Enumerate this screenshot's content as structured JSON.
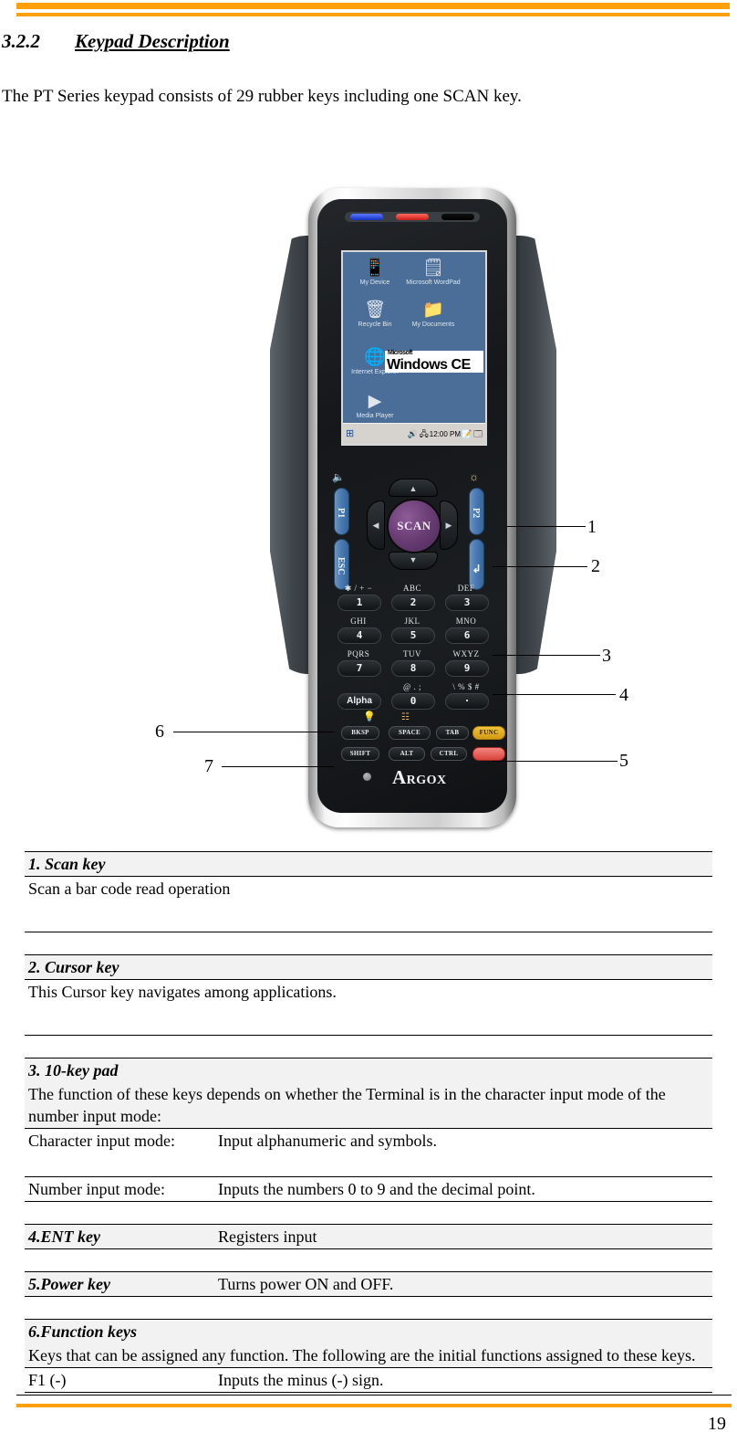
{
  "header": {
    "accent_color": "#FFA00A",
    "section_number": "3.2.2",
    "section_title": "Keypad Description"
  },
  "intro": "The PT Series keypad consists of 29 rubber keys including one SCAN key.",
  "device": {
    "brand_first_letter": "A",
    "brand_rest": "RGOX",
    "leds": [
      "led-blue",
      "led-red",
      "led-dark"
    ],
    "screen": {
      "os_logo_small": "Microsoft",
      "os_logo_large": "Windows CE",
      "icons": [
        {
          "name": "my-device",
          "glyph": "📱",
          "label": "My Device"
        },
        {
          "name": "microsoft-wordpad",
          "glyph": "🗒",
          "label": "Microsoft WordPad"
        },
        {
          "name": "recycle-bin",
          "glyph": "🗑",
          "label": "Recycle Bin"
        },
        {
          "name": "my-documents",
          "glyph": "📁",
          "label": "My Documents"
        },
        {
          "name": "internet-explorer",
          "glyph": "🌐",
          "label": "Internet Explorer"
        },
        {
          "name": "media-player",
          "glyph": "▶",
          "label": "Media Player"
        }
      ],
      "taskbar": {
        "start_glyph": "⊞",
        "tray_icons": [
          "🔊",
          "🖧"
        ],
        "clock": "12:00 PM",
        "tray_icons_right": [
          "📝",
          "🗔"
        ]
      }
    },
    "keys": {
      "p1": "P1",
      "esc": "ESC",
      "p2": "P2",
      "enter": "↲",
      "scan": "SCAN",
      "dpad_up": "▲",
      "dpad_down": "▼",
      "dpad_left": "◀",
      "dpad_right": "▶",
      "numeric": [
        {
          "top": "✱ / + −",
          "key": "1"
        },
        {
          "top": "ABC",
          "key": "2"
        },
        {
          "top": "DEF",
          "key": "3"
        },
        {
          "top": "GHI",
          "key": "4"
        },
        {
          "top": "JKL",
          "key": "5"
        },
        {
          "top": "MNO",
          "key": "6"
        },
        {
          "top": "PQRS",
          "key": "7"
        },
        {
          "top": "TUV",
          "key": "8"
        },
        {
          "top": "WXYZ",
          "key": "9"
        },
        {
          "top": "",
          "key": "Alpha"
        },
        {
          "top": "@ . ;",
          "key": "0"
        },
        {
          "top": "\\ % $ #",
          "key": "·"
        }
      ],
      "modifiers_row1": [
        "BKSP",
        "SPACE",
        "TAB",
        "FUNC"
      ],
      "modifiers_row2": [
        "SHIFT",
        "ALT",
        "CTRL",
        ""
      ]
    }
  },
  "callouts": [
    {
      "number": "1"
    },
    {
      "number": "2"
    },
    {
      "number": "3"
    },
    {
      "number": "4"
    },
    {
      "number": "5"
    },
    {
      "number": "6"
    },
    {
      "number": "7"
    }
  ],
  "table": {
    "scan_title": "1. Scan key",
    "scan_body": "Scan a bar code read operation",
    "cursor_title": "2. Cursor key",
    "cursor_body": "This Cursor key navigates among applications.",
    "tenkey_title": "3. 10-key pad",
    "tenkey_desc": "The function of these keys depends on whether the Terminal is in the character input mode of the number input mode:",
    "char_mode_label": "Character input mode:",
    "char_mode_value": "Input alphanumeric and symbols.",
    "num_mode_label": "Number input mode:",
    "num_mode_value": "Inputs the numbers 0 to 9 and the decimal point.",
    "ent_title": "4.ENT key",
    "ent_value": "Registers input",
    "power_title": "5.Power key",
    "power_value": "Turns power ON and OFF.",
    "func_title": "6.Function keys",
    "func_desc": "Keys that can be assigned any function. The following are the initial functions assigned to these keys.",
    "f1_label": "F1 (-)",
    "f1_value": "Inputs the minus (-) sign."
  },
  "footer": {
    "page_number": "19"
  }
}
